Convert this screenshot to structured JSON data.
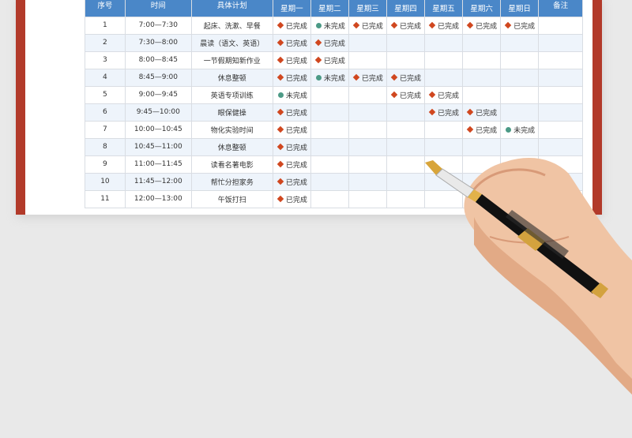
{
  "header": {
    "no": "序号",
    "time": "时间",
    "plan": "具体计划",
    "days": [
      "星期一",
      "星期二",
      "星期三",
      "星期四",
      "星期五",
      "星期六",
      "星期日"
    ],
    "note": "备注"
  },
  "legend": {
    "done": "已完成",
    "undone": "未完成"
  },
  "rows": [
    {
      "no": "1",
      "time": "7:00—7:30",
      "plan": "起床、洗漱、早餐",
      "days": [
        "done",
        "undone",
        "done",
        "done",
        "done",
        "done",
        "done"
      ]
    },
    {
      "no": "2",
      "time": "7:30—8:00",
      "plan": "晨读（语文、英语）",
      "days": [
        "done",
        "done",
        "",
        "",
        "",
        "",
        ""
      ]
    },
    {
      "no": "3",
      "time": "8:00—8:45",
      "plan": "一节假期知新作业",
      "days": [
        "done",
        "done",
        "",
        "",
        "",
        "",
        ""
      ]
    },
    {
      "no": "4",
      "time": "8:45—9:00",
      "plan": "休息整顿",
      "days": [
        "done",
        "undone",
        "done",
        "done",
        "",
        "",
        ""
      ]
    },
    {
      "no": "5",
      "time": "9:00—9:45",
      "plan": "英语专项训练",
      "days": [
        "undone",
        "",
        "",
        "done",
        "done",
        "",
        ""
      ]
    },
    {
      "no": "6",
      "time": "9:45—10:00",
      "plan": "眼保健操",
      "days": [
        "done",
        "",
        "",
        "",
        "done",
        "done",
        ""
      ]
    },
    {
      "no": "7",
      "time": "10:00—10:45",
      "plan": "物化实验时间",
      "days": [
        "done",
        "",
        "",
        "",
        "",
        "done",
        "undone"
      ]
    },
    {
      "no": "8",
      "time": "10:45—11:00",
      "plan": "休息整顿",
      "days": [
        "done",
        "",
        "",
        "",
        "",
        "",
        ""
      ]
    },
    {
      "no": "9",
      "time": "11:00—11:45",
      "plan": "读看名著电影",
      "days": [
        "done",
        "",
        "",
        "",
        "",
        "",
        ""
      ]
    },
    {
      "no": "10",
      "time": "11:45—12:00",
      "plan": "帮忙分担家务",
      "days": [
        "done",
        "",
        "",
        "",
        "",
        "",
        ""
      ]
    },
    {
      "no": "11",
      "time": "12:00—13:00",
      "plan": "午饭打扫",
      "days": [
        "done",
        "",
        "",
        "",
        "",
        "",
        ""
      ]
    }
  ]
}
